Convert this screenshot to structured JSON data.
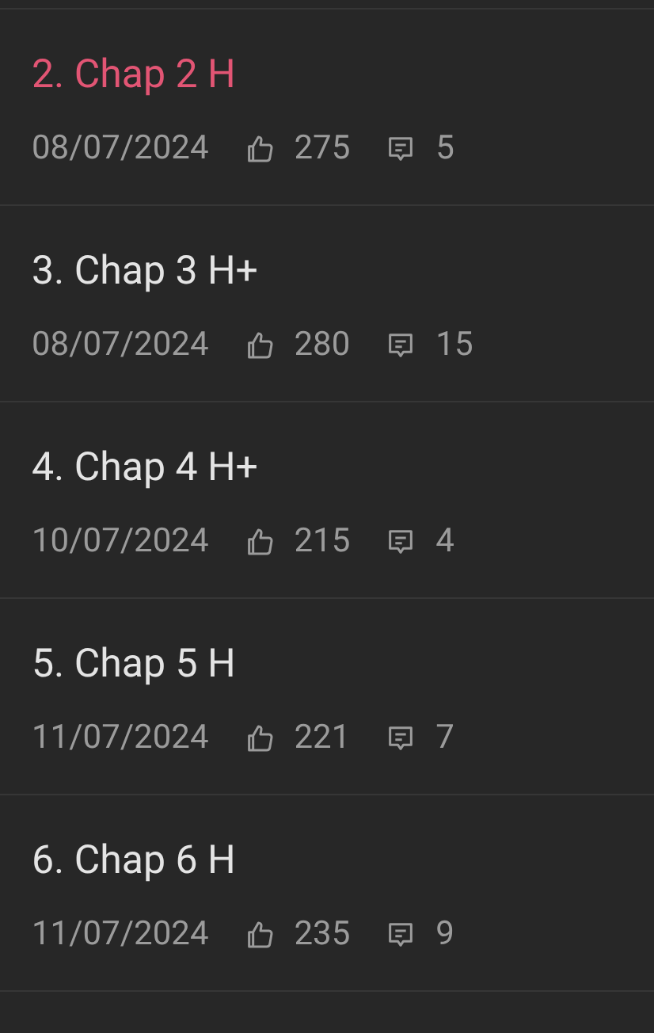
{
  "chapters": [
    {
      "title": "2. Chap 2 H",
      "selected": true,
      "date": "08/07/2024",
      "likes": "275",
      "comments": "5"
    },
    {
      "title": "3. Chap 3 H+",
      "selected": false,
      "date": "08/07/2024",
      "likes": "280",
      "comments": "15"
    },
    {
      "title": "4. Chap 4 H+",
      "selected": false,
      "date": "10/07/2024",
      "likes": "215",
      "comments": "4"
    },
    {
      "title": "5. Chap 5 H",
      "selected": false,
      "date": "11/07/2024",
      "likes": "221",
      "comments": "7"
    },
    {
      "title": "6. Chap 6 H",
      "selected": false,
      "date": "11/07/2024",
      "likes": "235",
      "comments": "9"
    }
  ]
}
